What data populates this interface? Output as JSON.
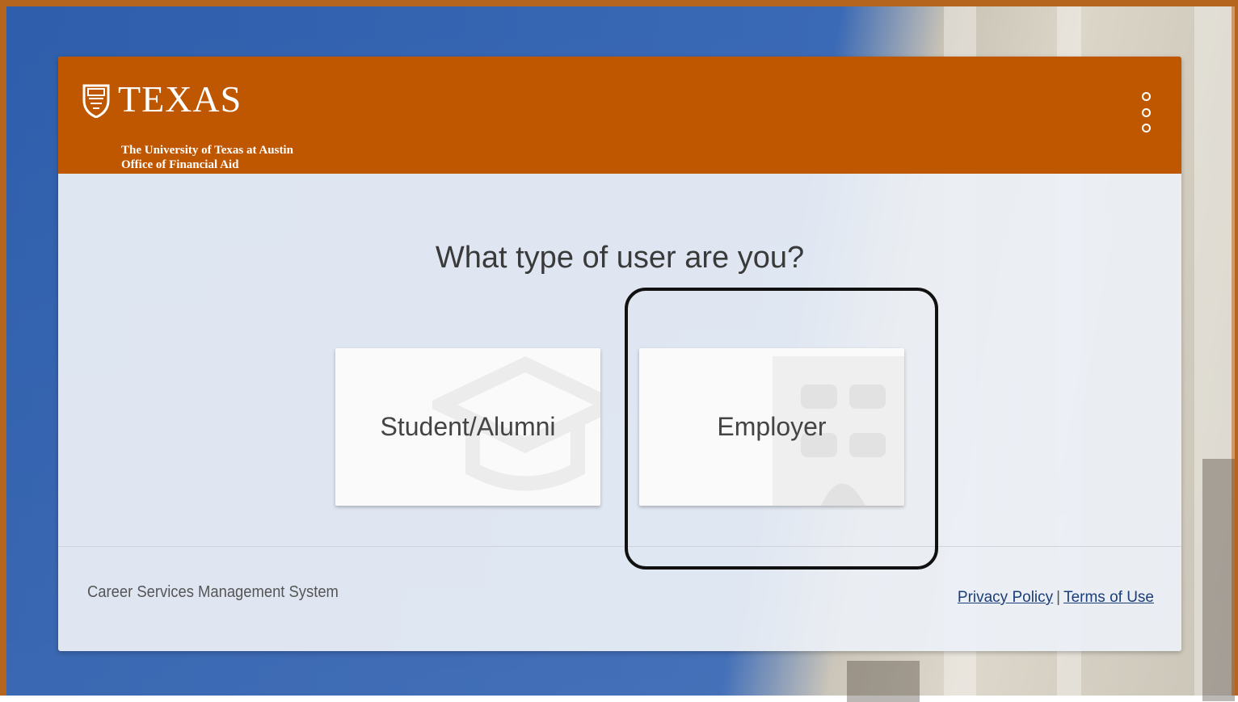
{
  "header": {
    "brand": "TEXAS",
    "subtitle_line1": "The University of Texas at Austin",
    "subtitle_line2": "Office of Financial Aid",
    "menu_icon": "more-vertical-icon",
    "color": "#bf5700"
  },
  "main": {
    "question": "What type of user are you?",
    "options": [
      {
        "label": "Student/Alumni",
        "icon": "graduation-cap-icon"
      },
      {
        "label": "Employer",
        "icon": "building-icon"
      }
    ]
  },
  "footer": {
    "system_name": "Career Services Management System",
    "privacy_label": "Privacy Policy",
    "separator": "|",
    "terms_label": "Terms of Use"
  }
}
